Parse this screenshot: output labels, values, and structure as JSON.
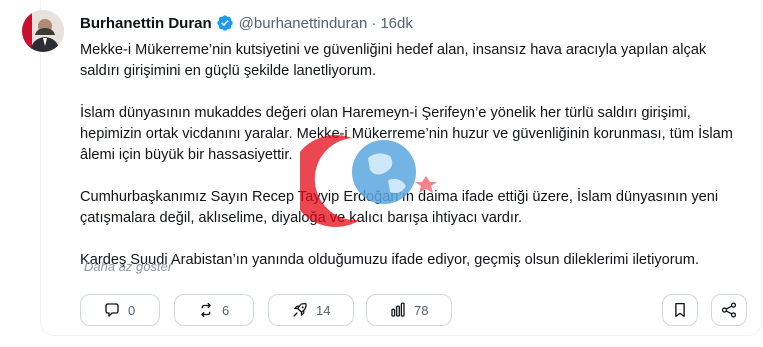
{
  "tweet": {
    "author_name": "Burhanettin Duran",
    "handle": "@burhanettinduran",
    "separator": "·",
    "time": "16dk",
    "paragraphs": [
      "Mekke-i Mükerreme’nin kutsiyetini ve güvenliğini hedef alan, insansız hava aracıyla yapılan alçak saldırı girişimini en güçlü şekilde lanetliyorum.",
      "İslam dünyasının mukaddes değeri olan Haremeyn-i Şerifeyn’e yönelik her türlü saldırı girişimi, hepimizin ortak vicdanını yaralar. Mekke-i Mükerreme’nin huzur ve güvenliğinin korunması, tüm İslam âlemi için büyük bir hassasiyettir.",
      "Cumhurbaşkanımız Sayın Recep Tayyip Erdoğan’ın daima ifade ettiği üzere, İslam dünyasının yeni çatışmalara değil, aklıselime, diyaloğa ve kalıcı barışa ihtiyacı vardır.",
      "Kardeş Suudi Arabistan’ın yanında olduğumuzu ifade ediyor, geçmiş olsun dileklerimi iletiyorum."
    ],
    "show_less": "Daha az göster"
  },
  "actions": {
    "replies": "0",
    "reposts": "6",
    "boosts": "14",
    "views": "78"
  },
  "colors": {
    "verified": "#1d9bf0",
    "text": "#0f1419",
    "muted": "#536471",
    "border": "#cfd9de"
  }
}
